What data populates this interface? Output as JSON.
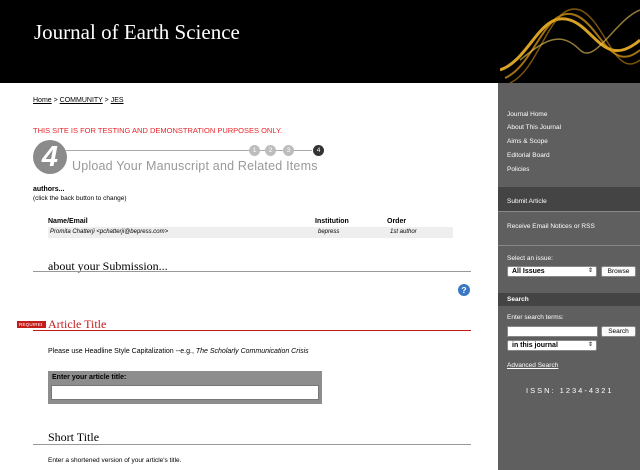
{
  "header": {
    "journal_title": "Journal of Earth Science"
  },
  "breadcrumb": {
    "home": "Home",
    "sep1": " > ",
    "community": "COMMUNITY",
    "sep2": " > ",
    "jes": "JES"
  },
  "notice": "THIS SITE IS FOR TESTING AND DEMONSTRATION PURPOSES ONLY.",
  "steps": {
    "current_number": "4",
    "title": "Upload Your Manuscript and Related Items",
    "dots": [
      "1",
      "2",
      "3",
      "4"
    ]
  },
  "authors": {
    "heading": "authors...",
    "hint": "(click the back button to change)",
    "columns": [
      "Name/Email",
      "Institution",
      "Order"
    ],
    "rows": [
      {
        "name_email": "Promita Chatterji <pchatterji@bepress.com>",
        "institution": "bepress",
        "order": "1st author"
      }
    ]
  },
  "about_heading": "about your Submission...",
  "help_icon": "?",
  "article_title": {
    "required_badge": "REQUIRED",
    "heading": "Article Title",
    "hint_prefix": "Please use Headline Style Capitalization --e.g., ",
    "hint_example": "The Scholarly Communication Crisis",
    "input_label": "Enter your article title:",
    "input_value": ""
  },
  "short_title": {
    "heading": "Short Title",
    "hint": "Enter a shortened version of your article's title."
  },
  "sidebar": {
    "nav": [
      "Journal Home",
      "About This Journal",
      "Aims & Scope",
      "Editorial Board",
      "Policies"
    ],
    "submit_article": "Submit Article",
    "email_notices": "Receive Email Notices or RSS",
    "select_issue_label": "Select an issue:",
    "issue_selected": "All Issues",
    "browse_button": "Browse",
    "search_heading": "Search",
    "search_terms_label": "Enter search terms:",
    "search_button": "Search",
    "search_value": "",
    "scope_selected": "in this journal",
    "advanced_search": "Advanced Search",
    "issn": "ISSN: 1234-4321"
  },
  "colors": {
    "header_bg": "#000000",
    "sidebar_bg": "#5f5f5f",
    "required_red": "#c41b1b",
    "notice_red": "#e8252b",
    "help_blue": "#3b78c4",
    "art_gold": "#f0b429"
  }
}
